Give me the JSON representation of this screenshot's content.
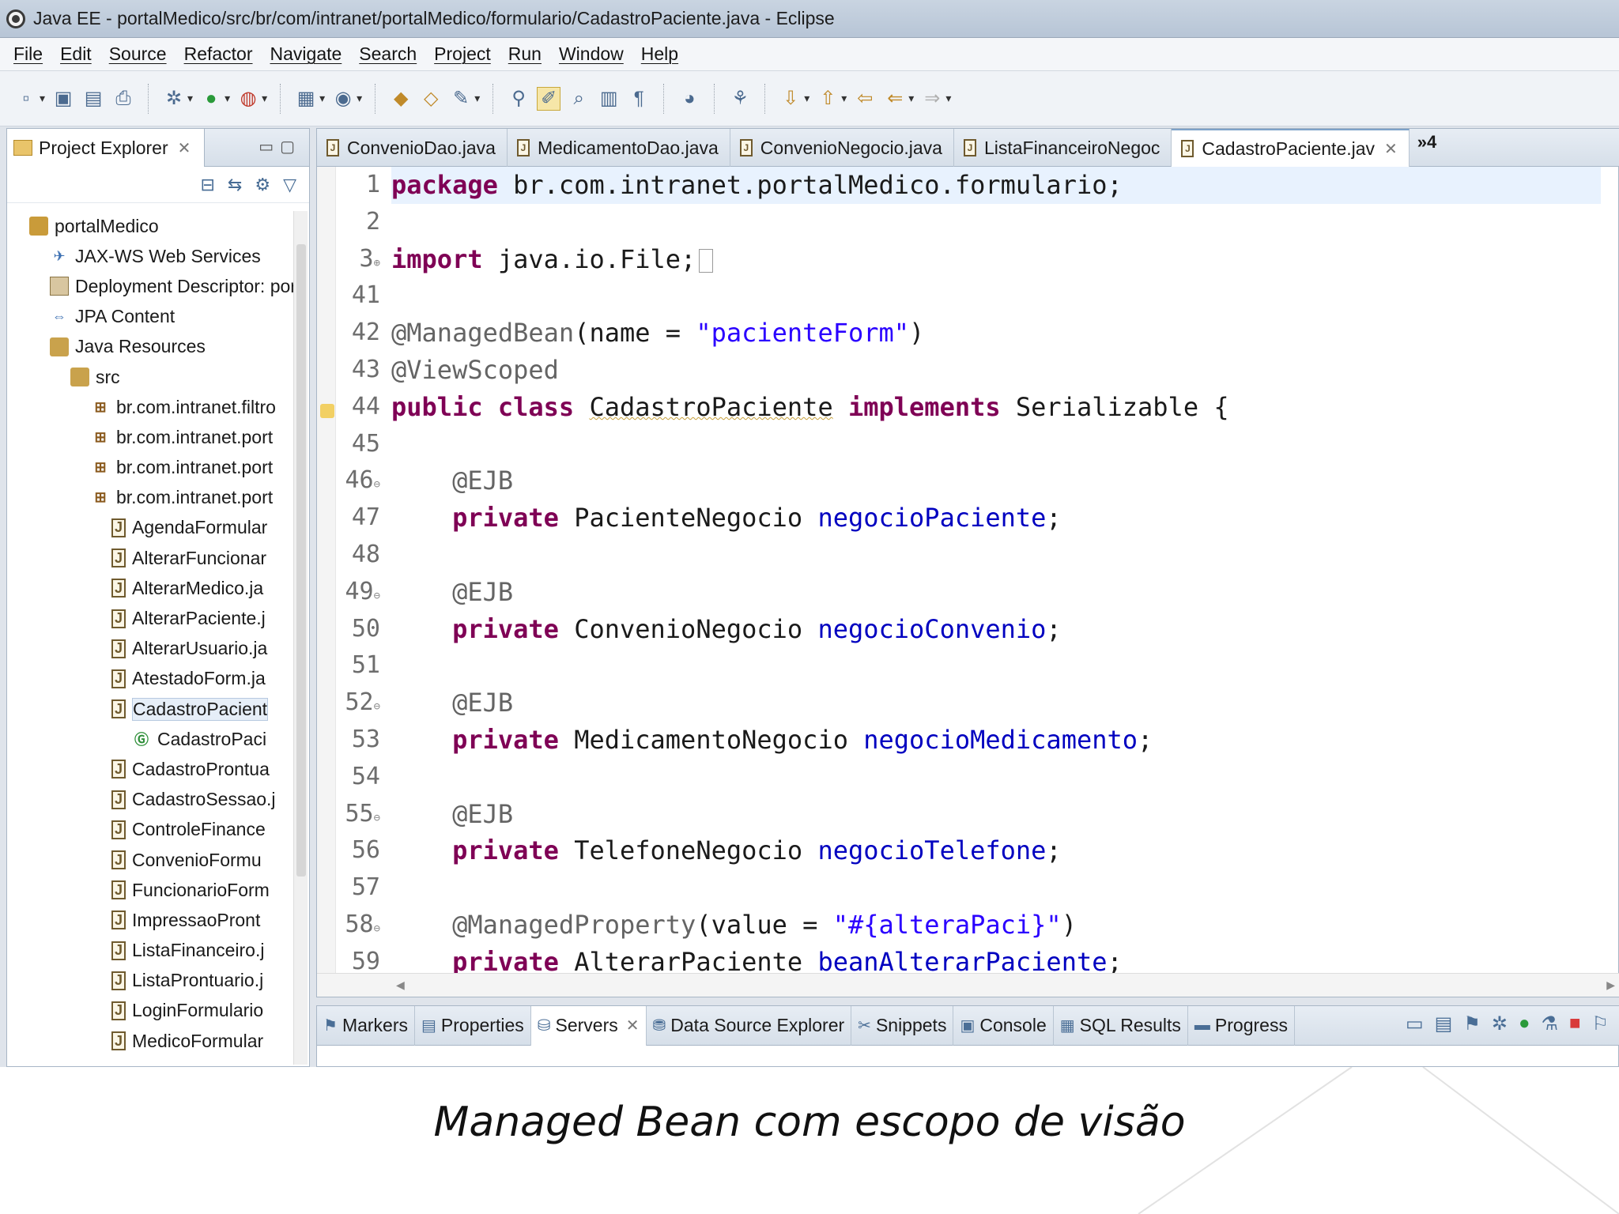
{
  "window": {
    "title": "Java EE - portalMedico/src/br/com/intranet/portalMedico/formulario/CadastroPaciente.java - Eclipse"
  },
  "menubar": [
    "File",
    "Edit",
    "Source",
    "Refactor",
    "Navigate",
    "Search",
    "Project",
    "Run",
    "Window",
    "Help"
  ],
  "explorer": {
    "title": "Project Explorer",
    "tree": [
      {
        "label": "portalMedico",
        "icon": "project-icon",
        "depth": 1
      },
      {
        "label": "JAX-WS Web Services",
        "icon": "web-services-icon",
        "depth": 2
      },
      {
        "label": "Deployment Descriptor: por",
        "icon": "deployment-descriptor-icon",
        "depth": 2
      },
      {
        "label": "JPA Content",
        "icon": "jpa-icon",
        "depth": 2
      },
      {
        "label": "Java Resources",
        "icon": "java-resources-icon",
        "depth": 2
      },
      {
        "label": "src",
        "icon": "source-folder-icon",
        "depth": 3
      },
      {
        "label": "br.com.intranet.filtro",
        "icon": "package-icon",
        "depth": 4
      },
      {
        "label": "br.com.intranet.port",
        "icon": "package-icon",
        "depth": 4
      },
      {
        "label": "br.com.intranet.port",
        "icon": "package-icon",
        "depth": 4
      },
      {
        "label": "br.com.intranet.port",
        "icon": "package-icon",
        "depth": 4
      },
      {
        "label": "AgendaFormular",
        "icon": "java-file-icon",
        "depth": 5
      },
      {
        "label": "AlterarFuncionar",
        "icon": "java-file-icon",
        "depth": 5
      },
      {
        "label": "AlterarMedico.ja",
        "icon": "java-file-icon",
        "depth": 5
      },
      {
        "label": "AlterarPaciente.j",
        "icon": "java-file-icon",
        "depth": 5
      },
      {
        "label": "AlterarUsuario.ja",
        "icon": "java-file-icon",
        "depth": 5
      },
      {
        "label": "AtestadoForm.ja",
        "icon": "java-file-icon",
        "depth": 5
      },
      {
        "label": "CadastroPacient",
        "icon": "java-file-icon",
        "depth": 5,
        "selected": true
      },
      {
        "label": "CadastroPaci",
        "icon": "class-icon",
        "depth": 6
      },
      {
        "label": "CadastroProntua",
        "icon": "java-file-icon",
        "depth": 5
      },
      {
        "label": "CadastroSessao.j",
        "icon": "java-file-icon",
        "depth": 5
      },
      {
        "label": "ControleFinance",
        "icon": "java-file-icon",
        "depth": 5
      },
      {
        "label": "ConvenioFormu",
        "icon": "java-file-icon",
        "depth": 5
      },
      {
        "label": "FuncionarioForm",
        "icon": "java-file-icon",
        "depth": 5
      },
      {
        "label": "ImpressaoPront",
        "icon": "java-file-icon",
        "depth": 5
      },
      {
        "label": "ListaFinanceiro.j",
        "icon": "java-file-icon",
        "depth": 5
      },
      {
        "label": "ListaProntuario.j",
        "icon": "java-file-icon",
        "depth": 5
      },
      {
        "label": "LoginFormulario",
        "icon": "java-file-icon",
        "depth": 5
      },
      {
        "label": "MedicoFormular",
        "icon": "java-file-icon",
        "depth": 5
      }
    ]
  },
  "editor": {
    "tabs": [
      {
        "label": "ConvenioDao.java",
        "active": false
      },
      {
        "label": "MedicamentoDao.java",
        "active": false
      },
      {
        "label": "ConvenioNegocio.java",
        "active": false
      },
      {
        "label": "ListaFinanceiroNegoc",
        "active": false
      },
      {
        "label": "CadastroPaciente.jav",
        "active": true
      }
    ],
    "overflow_label": "»4",
    "lines": [
      {
        "n": "1",
        "fold": "",
        "tokens": [
          [
            "kw",
            "package"
          ],
          [
            "",
            " br.com.intranet.portalMedico.formulario;"
          ]
        ],
        "current": true
      },
      {
        "n": "2",
        "fold": "",
        "tokens": []
      },
      {
        "n": "3",
        "fold": "⊕",
        "tokens": [
          [
            "kw",
            "import"
          ],
          [
            "",
            " java.io.File;"
          ]
        ],
        "collapsed": true
      },
      {
        "n": "41",
        "fold": "",
        "tokens": []
      },
      {
        "n": "42",
        "fold": "",
        "tokens": [
          [
            "an",
            "@ManagedBean"
          ],
          [
            "",
            "(name = "
          ],
          [
            "str",
            "\"pacienteForm\""
          ],
          [
            "",
            ")"
          ]
        ]
      },
      {
        "n": "43",
        "fold": "",
        "tokens": [
          [
            "an",
            "@ViewScoped"
          ]
        ]
      },
      {
        "n": "44",
        "fold": "",
        "tokens": [
          [
            "kw",
            "public"
          ],
          [
            "",
            " "
          ],
          [
            "kw",
            "class"
          ],
          [
            "",
            " "
          ],
          [
            "sq",
            "CadastroPaciente"
          ],
          [
            "",
            " "
          ],
          [
            "kw",
            "implements"
          ],
          [
            "",
            " Serializable {"
          ]
        ]
      },
      {
        "n": "45",
        "fold": "",
        "tokens": []
      },
      {
        "n": "46",
        "fold": "⊖",
        "tokens": [
          [
            "",
            "    "
          ],
          [
            "an",
            "@EJB"
          ]
        ]
      },
      {
        "n": "47",
        "fold": "",
        "tokens": [
          [
            "",
            "    "
          ],
          [
            "kw",
            "private"
          ],
          [
            "",
            " PacienteNegocio "
          ],
          [
            "fld",
            "negocioPaciente"
          ],
          [
            "",
            ";"
          ]
        ]
      },
      {
        "n": "48",
        "fold": "",
        "tokens": []
      },
      {
        "n": "49",
        "fold": "⊖",
        "tokens": [
          [
            "",
            "    "
          ],
          [
            "an",
            "@EJB"
          ]
        ]
      },
      {
        "n": "50",
        "fold": "",
        "tokens": [
          [
            "",
            "    "
          ],
          [
            "kw",
            "private"
          ],
          [
            "",
            " ConvenioNegocio "
          ],
          [
            "fld",
            "negocioConvenio"
          ],
          [
            "",
            ";"
          ]
        ]
      },
      {
        "n": "51",
        "fold": "",
        "tokens": []
      },
      {
        "n": "52",
        "fold": "⊖",
        "tokens": [
          [
            "",
            "    "
          ],
          [
            "an",
            "@EJB"
          ]
        ]
      },
      {
        "n": "53",
        "fold": "",
        "tokens": [
          [
            "",
            "    "
          ],
          [
            "kw",
            "private"
          ],
          [
            "",
            " MedicamentoNegocio "
          ],
          [
            "fld",
            "negocioMedicamento"
          ],
          [
            "",
            ";"
          ]
        ]
      },
      {
        "n": "54",
        "fold": "",
        "tokens": []
      },
      {
        "n": "55",
        "fold": "⊖",
        "tokens": [
          [
            "",
            "    "
          ],
          [
            "an",
            "@EJB"
          ]
        ]
      },
      {
        "n": "56",
        "fold": "",
        "tokens": [
          [
            "",
            "    "
          ],
          [
            "kw",
            "private"
          ],
          [
            "",
            " TelefoneNegocio "
          ],
          [
            "fld",
            "negocioTelefone"
          ],
          [
            "",
            ";"
          ]
        ]
      },
      {
        "n": "57",
        "fold": "",
        "tokens": []
      },
      {
        "n": "58",
        "fold": "⊖",
        "tokens": [
          [
            "",
            "    "
          ],
          [
            "an",
            "@ManagedProperty"
          ],
          [
            "",
            "(value = "
          ],
          [
            "str",
            "\"#{alteraPaci}\""
          ],
          [
            "",
            ")"
          ]
        ]
      },
      {
        "n": "59",
        "fold": "",
        "tokens": [
          [
            "",
            "    "
          ],
          [
            "kw",
            "private"
          ],
          [
            "",
            " AlterarPaciente "
          ],
          [
            "fld",
            "beanAlterarPaciente"
          ],
          [
            "",
            ";"
          ]
        ]
      }
    ]
  },
  "bottom_panel": {
    "tabs": [
      {
        "label": "Markers",
        "icon": "markers-icon",
        "active": false
      },
      {
        "label": "Properties",
        "icon": "properties-icon",
        "active": false
      },
      {
        "label": "Servers",
        "icon": "servers-icon",
        "active": true
      },
      {
        "label": "Data Source Explorer",
        "icon": "data-source-icon",
        "active": false
      },
      {
        "label": "Snippets",
        "icon": "snippets-icon",
        "active": false
      },
      {
        "label": "Console",
        "icon": "console-icon",
        "active": false
      },
      {
        "label": "SQL Results",
        "icon": "sql-results-icon",
        "active": false
      },
      {
        "label": "Progress",
        "icon": "progress-icon",
        "active": false
      }
    ]
  },
  "caption": "Managed Bean com escopo de visão",
  "colors": {
    "keyword": "#7f0055",
    "annotation": "#646464",
    "string": "#2a00ff",
    "field": "#0000c0"
  }
}
